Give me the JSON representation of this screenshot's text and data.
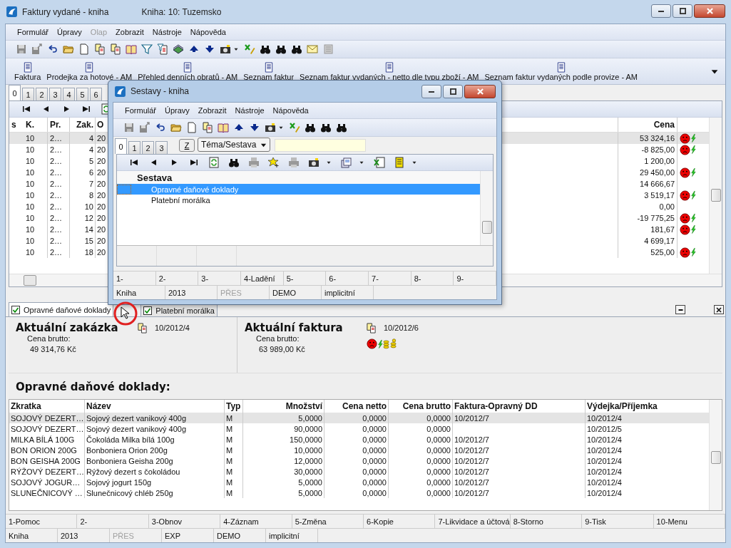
{
  "window": {
    "title": "Faktury vydané - kniha",
    "subtitle": "Kniha: 10: Tuzemsko"
  },
  "menu": [
    {
      "label": "Formulář",
      "disabled": false
    },
    {
      "label": "Úpravy",
      "disabled": false
    },
    {
      "label": "Olap",
      "disabled": true
    },
    {
      "label": "Zobrazit",
      "disabled": false
    },
    {
      "label": "Nástroje",
      "disabled": false
    },
    {
      "label": "Nápověda",
      "disabled": false
    }
  ],
  "reports": [
    "Faktura",
    "Prodejka za hotové - AM",
    "Přehled denních obratů - AM",
    "Seznam faktur",
    "Seznam faktur vydaných - netto dle typu zboží - AM",
    "Seznam faktur vydaných podle provize - AM"
  ],
  "tabs": [
    {
      "label": "0",
      "selected": true
    },
    {
      "label": "1",
      "selected": false
    },
    {
      "label": "2",
      "selected": false
    },
    {
      "label": "3",
      "selected": false
    },
    {
      "label": "4",
      "selected": false
    },
    {
      "label": "5",
      "selected": false
    },
    {
      "label": "6",
      "selected": false
    }
  ],
  "table": {
    "columns": [
      "s",
      "K.",
      "Pr.",
      "Zak.",
      "O"
    ],
    "price_column": "Cena",
    "rows": [
      {
        "selected": true,
        "k": "10",
        "pr": "2…",
        "zak": "4",
        "ob": "20",
        "cena": "53 324,16",
        "alert": true
      },
      {
        "selected": false,
        "k": "10",
        "pr": "2…",
        "zak": "4",
        "ob": "20",
        "cena": "-8 825,00",
        "alert": true
      },
      {
        "selected": false,
        "k": "10",
        "pr": "2…",
        "zak": "5",
        "ob": "20",
        "cena": "1 200,00",
        "alert": false
      },
      {
        "selected": false,
        "k": "10",
        "pr": "2…",
        "zak": "6",
        "ob": "20",
        "cena": "29 450,00",
        "alert": true
      },
      {
        "selected": false,
        "k": "10",
        "pr": "2…",
        "zak": "7",
        "ob": "20",
        "cena": "14 666,67",
        "alert": false
      },
      {
        "selected": false,
        "k": "10",
        "pr": "2…",
        "zak": "8",
        "ob": "20",
        "cena": "3 519,17",
        "alert": true
      },
      {
        "selected": false,
        "k": "10",
        "pr": "2…",
        "zak": "10",
        "ob": "20",
        "cena": "0,00",
        "alert": false
      },
      {
        "selected": false,
        "k": "10",
        "pr": "2…",
        "zak": "12",
        "ob": "20",
        "cena": "-19 775,25",
        "alert": true
      },
      {
        "selected": false,
        "k": "10",
        "pr": "2…",
        "zak": "14",
        "ob": "20",
        "cena": "181,67",
        "alert": true
      },
      {
        "selected": false,
        "k": "10",
        "pr": "2…",
        "zak": "15",
        "ob": "20",
        "cena": "4 699,17",
        "alert": false
      },
      {
        "selected": false,
        "k": "10",
        "pr": "2…",
        "zak": "18",
        "ob": "20",
        "cena": "525,00",
        "alert": true
      }
    ]
  },
  "dialog": {
    "title": "Sestavy - kniha",
    "menu": [
      "Formulář",
      "Úpravy",
      "Zobrazit",
      "Nástroje",
      "Nápověda"
    ],
    "tabs": [
      {
        "label": "0",
        "selected": true
      },
      {
        "label": "1",
        "selected": false
      },
      {
        "label": "2",
        "selected": false
      },
      {
        "label": "3",
        "selected": false
      }
    ],
    "z_button": "Z",
    "theme_select": "Téma/Sestava",
    "list_header": "Sestava",
    "items": [
      {
        "label": "Opravné daňové doklady",
        "selected": true
      },
      {
        "label": "Platební morálka",
        "selected": false
      }
    ],
    "function_keys": [
      "1-",
      "2-",
      "3-",
      "4-Ladění",
      "5-",
      "6-",
      "7-",
      "8-",
      "9-"
    ],
    "status_bar": [
      {
        "text": "Kniha",
        "disabled": false
      },
      {
        "text": "2013",
        "disabled": false
      },
      {
        "text": "PŘES",
        "disabled": true
      },
      {
        "text": "DEMO",
        "disabled": false
      },
      {
        "text": "implicitní",
        "disabled": false
      }
    ]
  },
  "detail_tabs": [
    {
      "label": "Opravné daňové doklady",
      "checked": true,
      "selected": true
    },
    {
      "label": "Platební morálka",
      "checked": true,
      "selected": false
    }
  ],
  "order": {
    "heading": "Aktuální zakázka",
    "number": "10/2012/4",
    "price_label": "Cena brutto:",
    "price": "49 314,76 Kč"
  },
  "invoice": {
    "heading": "Aktuální faktura",
    "number": "10/2012/6",
    "price_label": "Cena brutto:",
    "price": "63 989,00 Kč",
    "alert": true
  },
  "section_heading": "Opravné daňové doklady:",
  "items": {
    "columns": [
      "Zkratka",
      "Název",
      "Typ",
      "Množství",
      "Cena netto",
      "Cena brutto",
      "Faktura-Opravný DD",
      "Výdejka/Příjemka"
    ],
    "rows": [
      {
        "selected": true,
        "cells": [
          "SOJOVÝ DEZERT…",
          "Sojový dezert vanikový 400g",
          "M",
          "5,0000",
          "0,0000",
          "0,0000",
          "10/2012/7",
          "10/2012/4"
        ]
      },
      {
        "selected": false,
        "cells": [
          "SOJOVÝ DEZERT…",
          "Sojový dezert vanikový 400g",
          "M",
          "90,0000",
          "0,0000",
          "0,0000",
          "",
          "10/2012/5"
        ]
      },
      {
        "selected": false,
        "cells": [
          "MILKA BÍLÁ 100G",
          "Čokoláda Milka bílá 100g",
          "M",
          "150,0000",
          "0,0000",
          "0,0000",
          "10/2012/7",
          "10/2012/4"
        ]
      },
      {
        "selected": false,
        "cells": [
          "BON ORION 200G",
          "Bonboniera Orion 200g",
          "M",
          "10,0000",
          "0,0000",
          "0,0000",
          "10/2012/7",
          "10/2012/4"
        ]
      },
      {
        "selected": false,
        "cells": [
          "BON GEISHA 200G",
          "Bonboniera Geisha 200g",
          "M",
          "12,0000",
          "0,0000",
          "0,0000",
          "10/2012/7",
          "10/2012/4"
        ]
      },
      {
        "selected": false,
        "cells": [
          "RÝŽOVÝ DEZERT…",
          "Rýžový dezert s čokoládou",
          "M",
          "30,0000",
          "0,0000",
          "0,0000",
          "10/2012/7",
          "10/2012/4"
        ]
      },
      {
        "selected": false,
        "cells": [
          "SOJOVÝ JOGUR…",
          "Sojový jogurt 150g",
          "M",
          "5,0000",
          "0,0000",
          "0,0000",
          "10/2012/7",
          "10/2012/4"
        ]
      },
      {
        "selected": false,
        "cells": [
          "SLUNEČNICOVÝ …",
          "Slunečnicový chléb 250g",
          "M",
          "5,0000",
          "0,0000",
          "0,0000",
          "10/2012/7",
          "10/2012/4"
        ]
      }
    ]
  },
  "function_keys": [
    "1-Pomoc",
    "2-",
    "3-Obnov",
    "4-Záznam",
    "5-Změna",
    "6-Kopie",
    "7-Likvidace a účtová",
    "8-Storno",
    "9-Tisk",
    "10-Menu"
  ],
  "status_bar": [
    {
      "text": "Kniha",
      "disabled": false
    },
    {
      "text": "2013",
      "disabled": false
    },
    {
      "text": "PŘES",
      "disabled": true
    },
    {
      "text": "EXP",
      "disabled": false
    },
    {
      "text": "DEMO",
      "disabled": false
    },
    {
      "text": "implicitní",
      "disabled": false
    }
  ]
}
